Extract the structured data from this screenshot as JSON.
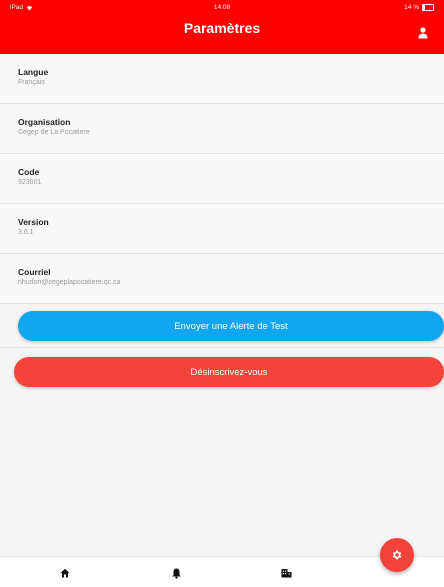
{
  "status_bar": {
    "carrier": "iPad",
    "time": "14:08",
    "battery": "14 %"
  },
  "header": {
    "title": "Paramètres",
    "right_icon": "user-icon"
  },
  "settings": [
    {
      "label": "Langue",
      "value": "Français"
    },
    {
      "label": "Organisation",
      "value": "Cegep de La Pocatiere"
    },
    {
      "label": "Code",
      "value": "923001"
    },
    {
      "label": "Version",
      "value": "3.0.1"
    },
    {
      "label": "Courriel",
      "value": "nhudon@cegeplapocatiere.qc.ca"
    }
  ],
  "actions": {
    "test_alert_label": "Envoyer une Alerte de Test",
    "unsubscribe_label": "Désinscrivez-vous"
  },
  "fab": {
    "icon": "gear-icon"
  },
  "bottom_nav": [
    {
      "icon": "home-icon"
    },
    {
      "icon": "bell-icon"
    },
    {
      "icon": "building-icon"
    }
  ],
  "colors": {
    "header": "#ff0000",
    "test_button": "#12a6f0",
    "unsubscribe_button": "#f4433b",
    "fab": "#f4433b"
  }
}
